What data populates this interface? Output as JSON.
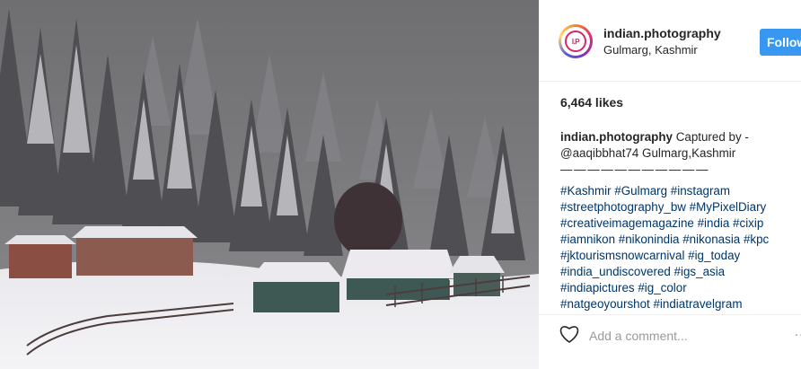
{
  "post": {
    "image_description_icon": "snowy-landscape-photo",
    "username": "indian.photography",
    "location": "Gulmarg, Kashmir",
    "avatar_text": "I.P",
    "follow_label": "Follow",
    "likes": "6,464 likes",
    "caption": {
      "user": "indian.photography",
      "text_line1": "Captured by -",
      "text_line2": "@aaqibbhat74 Gulmarg,Kashmir",
      "divider": "— — — — — — — — — — —",
      "hashtags": [
        "#Kashmir #Gulmarg #instagram",
        "#streetphotography_bw #MyPixelDiary",
        "#creativeimagemagazine #india #cixip",
        "#iamnikon #nikonindia #nikonasia #kpc",
        "#jktourismsnowcarnival #ig_today",
        "#india_undiscovered #igs_asia",
        "#indiapictures #ig_color",
        "#natgeoyourshot #indiatravelgram"
      ]
    },
    "comment_placeholder": "Add a comment...",
    "more_icon": "…"
  },
  "colors": {
    "follow_button": "#3897f0",
    "hashtag": "#003569",
    "avatar_ring": "#d6266a"
  }
}
